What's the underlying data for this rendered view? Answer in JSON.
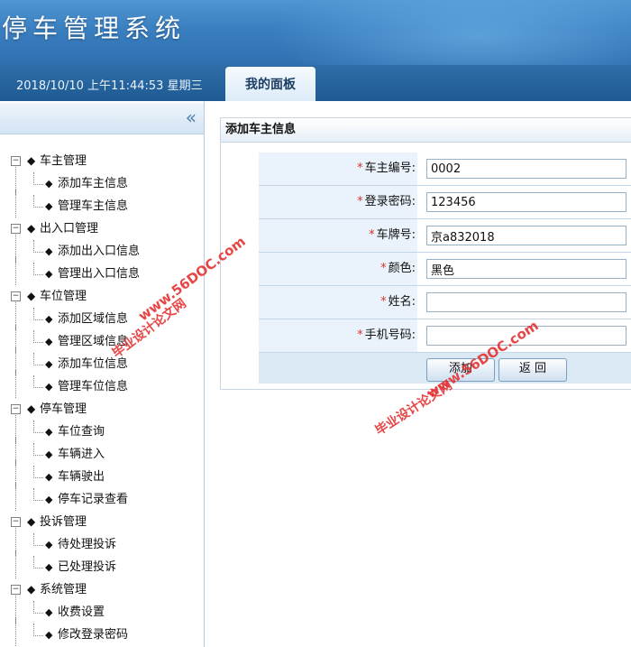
{
  "header": {
    "system_title": "停车管理系统"
  },
  "navbar": {
    "datetime": "2018/10/10 上午11:44:53 星期三",
    "active_tab": "我的面板"
  },
  "sidebar": {
    "collapse_glyph": "«",
    "groups": [
      {
        "label": "车主管理",
        "items": [
          "添加车主信息",
          "管理车主信息"
        ]
      },
      {
        "label": "出入口管理",
        "items": [
          "添加出入口信息",
          "管理出入口信息"
        ]
      },
      {
        "label": "车位管理",
        "items": [
          "添加区域信息",
          "管理区域信息",
          "添加车位信息",
          "管理车位信息"
        ]
      },
      {
        "label": "停车管理",
        "items": [
          "车位查询",
          "车辆进入",
          "车辆驶出",
          "停车记录查看"
        ]
      },
      {
        "label": "投诉管理",
        "items": [
          "待处理投诉",
          "已处理投诉"
        ]
      },
      {
        "label": "系统管理",
        "items": [
          "收费设置",
          "修改登录密码"
        ]
      }
    ]
  },
  "main": {
    "panel_title": "添加车主信息",
    "required_mark": "*",
    "fields": [
      {
        "label": "车主编号:",
        "value": "0002"
      },
      {
        "label": "登录密码:",
        "value": "123456"
      },
      {
        "label": "车牌号:",
        "value": "京a832018"
      },
      {
        "label": "颜色:",
        "value": "黑色"
      },
      {
        "label": "姓名:",
        "value": ""
      },
      {
        "label": "手机号码:",
        "value": ""
      }
    ],
    "buttons": {
      "add": "添加",
      "back": "返 回"
    }
  },
  "watermarks": {
    "site": "www.56DOC.com",
    "name": "毕业设计论文网"
  },
  "colors": {
    "header_blue": "#3a7fc0",
    "nav_blue": "#1f5a92",
    "required_red": "#d4342c",
    "watermark_red": "#e53333"
  }
}
